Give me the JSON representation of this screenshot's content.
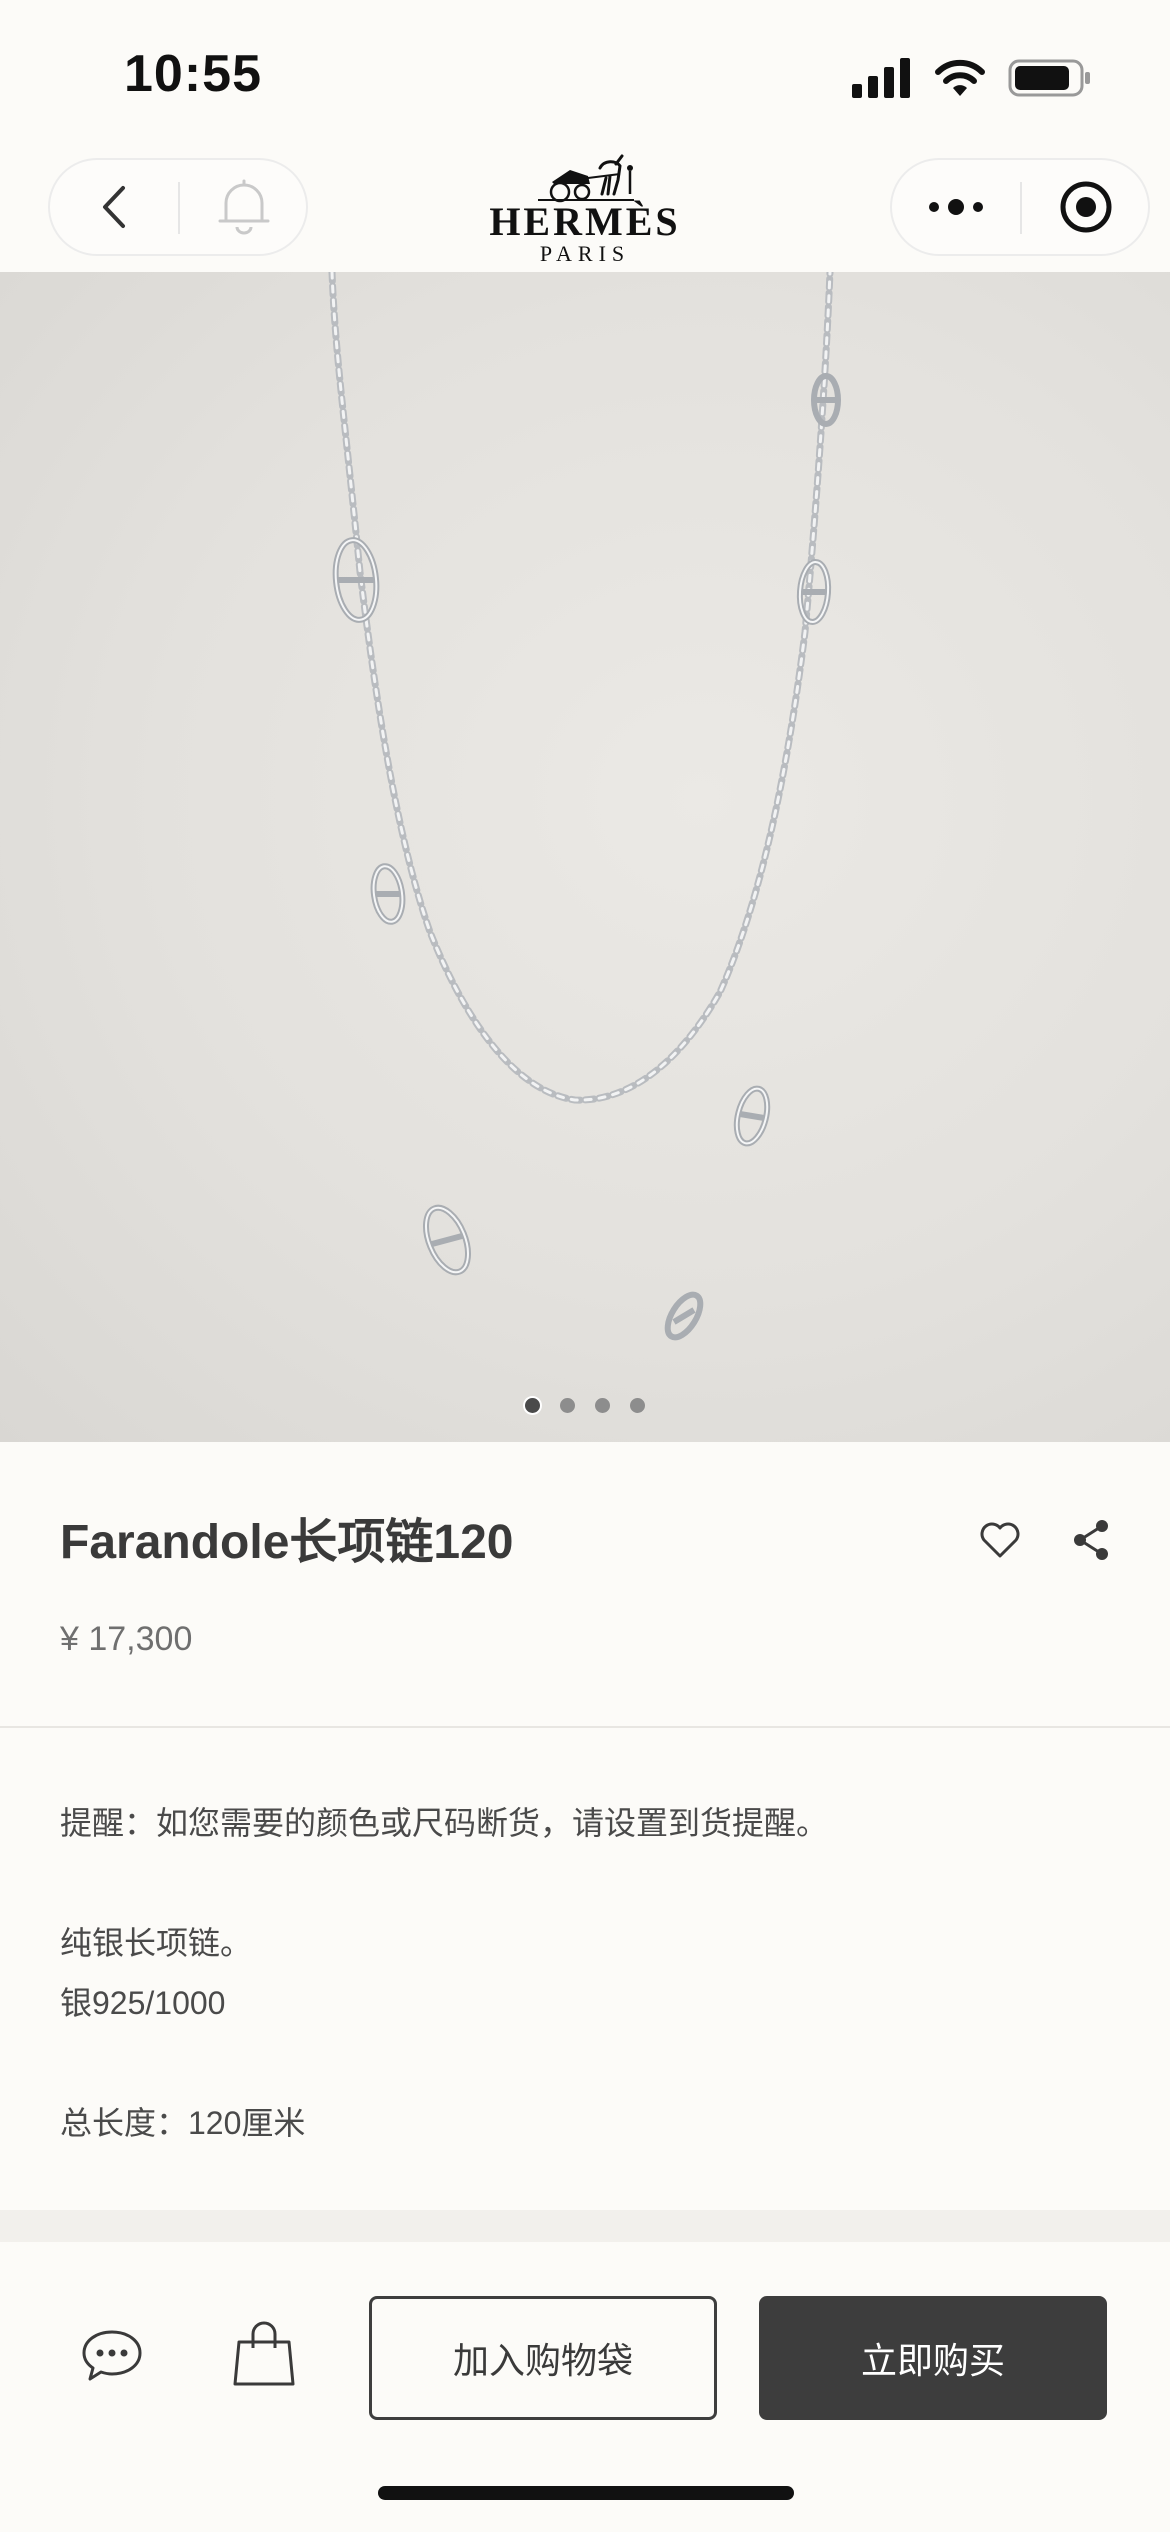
{
  "status_bar": {
    "time": "10:55"
  },
  "nav": {
    "brand_name": "HERMÈS",
    "brand_sub": "PARIS",
    "icons": [
      "back-icon",
      "bell-icon",
      "more-icon",
      "close-target-icon"
    ]
  },
  "gallery": {
    "image_count": 4,
    "active_index": 0
  },
  "product": {
    "title": "Farandole长项链120",
    "price": "¥ 17,300"
  },
  "description": {
    "notice": "提醒：如您需要的颜色或尺码断货，请设置到货提醒。",
    "line1": "纯银长项链。",
    "line2": "银925/1000",
    "line3": "总长度：120厘米"
  },
  "bottom_bar": {
    "add_to_bag": "加入购物袋",
    "buy_now": "立即购买"
  },
  "colors": {
    "background": "#fcfbf8",
    "primary_dark": "#3d3d3d",
    "text": "#3a3a3a",
    "muted": "#6f6f6f"
  }
}
